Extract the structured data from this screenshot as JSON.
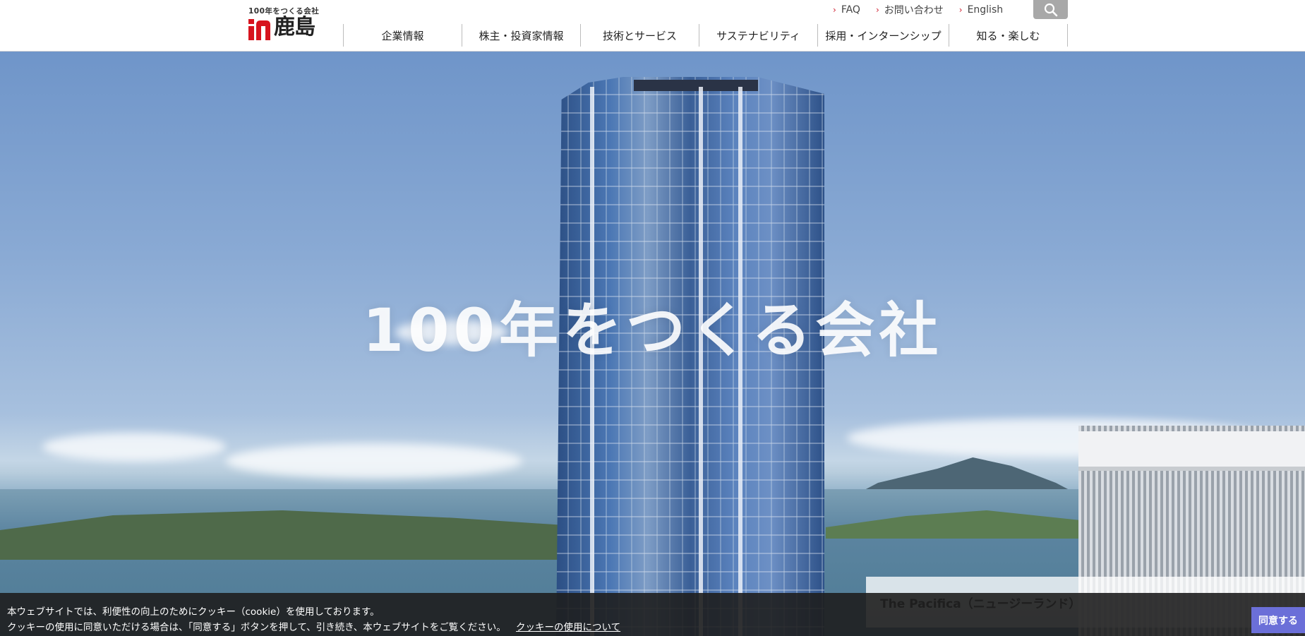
{
  "logo": {
    "tagline": "100年をつくる会社",
    "name": "鹿島",
    "mark_color": "#d7141e"
  },
  "utility_nav": [
    {
      "label": "FAQ",
      "icon": "chevron-right-icon"
    },
    {
      "label": "お問い合わせ",
      "icon": "chevron-right-icon"
    },
    {
      "label": "English",
      "icon": "chevron-right-icon"
    }
  ],
  "search": {
    "icon": "search-icon"
  },
  "global_nav": [
    {
      "label": "企業情報"
    },
    {
      "label": "株主・投資家情報"
    },
    {
      "label": "技術とサービス"
    },
    {
      "label": "サステナビリティ"
    },
    {
      "label": "採用・インターンシップ"
    },
    {
      "label": "知る・楽しむ"
    }
  ],
  "hero": {
    "title": "100年をつくる会社",
    "caption": "The Pacifica（ニュージーランド）"
  },
  "cookie": {
    "line1": "本ウェブサイトでは、利便性の向上のためにクッキー（cookie）を使用しております。",
    "line2": "クッキーの使用に同意いただける場合は、「同意する」ボタンを押して、引き続き、本ウェブサイトをご覧ください。",
    "link": "クッキーの使用について",
    "agree": "同意する",
    "button_color": "#6b6fd8"
  }
}
